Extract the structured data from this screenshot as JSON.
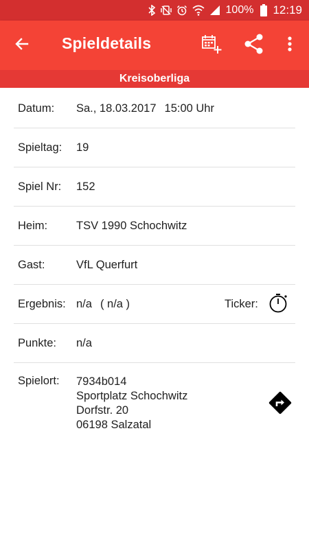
{
  "status_bar": {
    "battery": "100%",
    "time": "12:19",
    "icons": [
      "bluetooth-icon",
      "vibrate-icon",
      "alarm-icon",
      "wifi-icon",
      "signal-icon",
      "battery-icon"
    ]
  },
  "app_bar": {
    "title": "Spieldetails",
    "icons": [
      "back-arrow-icon",
      "add-to-calendar-icon",
      "share-icon",
      "more-vert-icon"
    ]
  },
  "league": "Kreisoberliga",
  "details": {
    "date": {
      "label": "Datum:",
      "value": "Sa., 18.03.2017",
      "time": "15:00 Uhr"
    },
    "matchday": {
      "label": "Spieltag:",
      "value": "19"
    },
    "match_no": {
      "label": "Spiel Nr:",
      "value": "152"
    },
    "home": {
      "label": "Heim:",
      "value": "TSV 1990 Schochwitz"
    },
    "away": {
      "label": "Gast:",
      "value": "VfL Querfurt"
    },
    "result": {
      "label": "Ergebnis:",
      "value": "n/a",
      "halftime": "( n/a )",
      "ticker_label": "Ticker:"
    },
    "points": {
      "label": "Punkte:",
      "value": "n/a"
    },
    "venue": {
      "label": "Spielort:",
      "lines": [
        "7934b014",
        "Sportplatz Schochwitz",
        "Dorfstr. 20",
        "06198 Salzatal"
      ]
    }
  },
  "colors": {
    "status_bar": "#d32f2f",
    "app_bar": "#f44336",
    "league_bar": "#e53935",
    "text": "#212121",
    "divider": "#e0e0e0"
  }
}
